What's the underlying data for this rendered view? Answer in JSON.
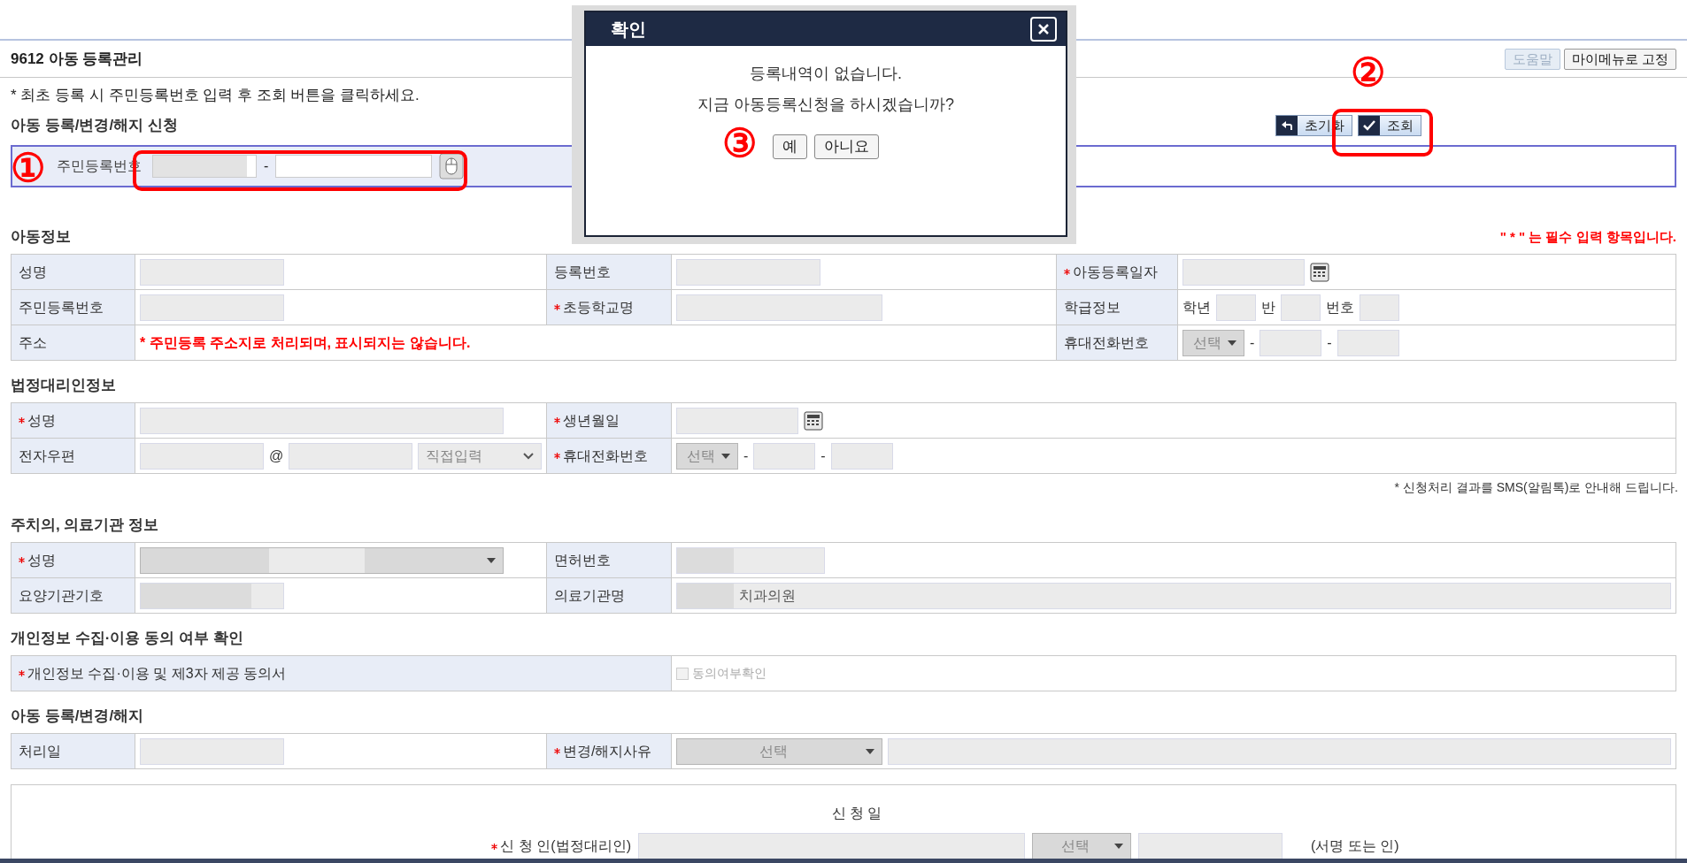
{
  "page": {
    "title": "9612 아동 등록관리",
    "buttons": [
      {
        "label": "도움말",
        "disabled": true
      },
      {
        "label": "마이메뉴로 고정",
        "disabled": false
      }
    ]
  },
  "notice": "* 최초 등록 시 주민등록번호 입력 후 조회 버튼을 클릭하세요.",
  "search": {
    "heading": "아동 등록/변경/해지 신청",
    "buttons": [
      {
        "label": "초기화",
        "kind": "reset"
      },
      {
        "label": "조회",
        "kind": "check"
      }
    ],
    "label": "주민등록번호",
    "separator": "-"
  },
  "sections": [
    {
      "heading": "아동정보",
      "note": "\" * \" 는 필수 입력 항목입니다.",
      "rows": [
        [
          {
            "kind": "label",
            "text": "성명",
            "required": false
          },
          {
            "kind": "value",
            "items": [
              {
                "kind": "input"
              }
            ]
          },
          {
            "kind": "label",
            "text": "등록번호",
            "required": false
          },
          {
            "kind": "value",
            "items": [
              {
                "kind": "input"
              }
            ]
          },
          {
            "kind": "label",
            "text": "아동등록일자",
            "required": true
          },
          {
            "kind": "value",
            "items": [
              {
                "kind": "input"
              },
              {
                "kind": "calendar"
              }
            ]
          }
        ],
        [
          {
            "kind": "label",
            "text": "주민등록번호",
            "required": false
          },
          {
            "kind": "value",
            "items": [
              {
                "kind": "input"
              }
            ]
          },
          {
            "kind": "label",
            "text": "초등학교명",
            "required": true
          },
          {
            "kind": "value",
            "items": [
              {
                "kind": "input"
              }
            ]
          },
          {
            "kind": "label",
            "text": "학급정보",
            "required": false
          },
          {
            "kind": "value",
            "items": [
              {
                "kind": "text",
                "text": "학년"
              },
              {
                "kind": "input"
              },
              {
                "kind": "text",
                "text": "반"
              },
              {
                "kind": "input"
              },
              {
                "kind": "text",
                "text": "번호"
              },
              {
                "kind": "input"
              }
            ]
          }
        ],
        [
          {
            "kind": "label",
            "text": "주소",
            "required": false
          },
          {
            "kind": "note",
            "text": "* 주민등록 주소지로 처리되며, 표시되지는 않습니다."
          },
          "",
          "",
          {
            "kind": "label",
            "text": "휴대전화번호",
            "required": false
          },
          {
            "kind": "value",
            "items": [
              {
                "kind": "select",
                "text": "선택"
              },
              {
                "kind": "text",
                "text": "-"
              },
              {
                "kind": "input"
              },
              {
                "kind": "text",
                "text": "-"
              },
              {
                "kind": "input"
              }
            ]
          }
        ]
      ]
    },
    {
      "heading": "법정대리인정보",
      "footnote": "* 신청처리 결과를 SMS(알림톡)로 안내해 드립니다.",
      "rows": [
        [
          {
            "kind": "label",
            "text": "성명",
            "required": true
          },
          {
            "kind": "value",
            "items": [
              {
                "kind": "input"
              }
            ]
          },
          {
            "kind": "label",
            "text": "생년월일",
            "required": true
          },
          {
            "kind": "value",
            "items": [
              {
                "kind": "input"
              },
              {
                "kind": "calendar"
              }
            ]
          }
        ],
        [
          {
            "kind": "label",
            "text": "전자우편",
            "required": false
          },
          {
            "kind": "value",
            "items": [
              {
                "kind": "input"
              },
              {
                "kind": "text",
                "text": "@"
              },
              {
                "kind": "input"
              },
              {
                "kind": "dropdown",
                "text": "직접입력"
              }
            ]
          },
          {
            "kind": "label",
            "text": "휴대전화번호",
            "required": true
          },
          {
            "kind": "value",
            "items": [
              {
                "kind": "select",
                "text": "선택"
              },
              {
                "kind": "text",
                "text": "-"
              },
              {
                "kind": "input"
              },
              {
                "kind": "text",
                "text": "-"
              },
              {
                "kind": "input"
              }
            ]
          }
        ]
      ]
    },
    {
      "heading": "주치의, 의료기관 정보",
      "rows": [
        [
          {
            "kind": "label",
            "text": "성명",
            "required": true
          },
          {
            "kind": "value",
            "items": [
              {
                "kind": "select",
                "redacted": true
              }
            ]
          },
          {
            "kind": "label",
            "text": "면허번호",
            "required": false
          },
          {
            "kind": "value",
            "items": [
              {
                "kind": "input",
                "redacted": true
              }
            ]
          }
        ],
        [
          {
            "kind": "label",
            "text": "요양기관기호",
            "required": false
          },
          {
            "kind": "value",
            "items": [
              {
                "kind": "input",
                "redacted": true
              }
            ]
          },
          {
            "kind": "label",
            "text": "의료기관명",
            "required": false
          },
          {
            "kind": "value",
            "items": [
              {
                "kind": "input",
                "redacted": true,
                "value": "치과의원"
              }
            ]
          }
        ]
      ]
    },
    {
      "heading": "개인정보 수집·이용 동의 여부 확인",
      "rows": [
        [
          {
            "kind": "label",
            "text": "개인정보 수집·이용 및 제3자 제공 동의서",
            "required": true
          },
          {
            "kind": "value",
            "items": [
              {
                "kind": "checkbox",
                "text": "동의여부확인",
                "checked": false,
                "disabled": true
              }
            ]
          }
        ]
      ]
    },
    {
      "heading": "아동 등록/변경/해지",
      "rows": [
        [
          {
            "kind": "label",
            "text": "처리일",
            "required": false
          },
          {
            "kind": "value",
            "items": [
              {
                "kind": "input"
              }
            ]
          },
          {
            "kind": "label",
            "text": "변경/해지사유",
            "required": true
          },
          {
            "kind": "value",
            "items": [
              {
                "kind": "select",
                "text": "선택"
              },
              {
                "kind": "input"
              }
            ]
          }
        ]
      ]
    }
  ],
  "application": {
    "date_label": "신 청 일",
    "applicant_label": "신 청 인(법정대리인)",
    "required": true,
    "items": [
      {
        "kind": "input"
      },
      {
        "kind": "select",
        "text": "선택"
      },
      {
        "kind": "input"
      }
    ],
    "suffix": "(서명 또는 인)"
  },
  "dialog": {
    "title": "확인",
    "lines": [
      "등록내역이 없습니다.",
      "지금 아동등록신청을 하시겠습니까?"
    ],
    "buttons": [
      "예",
      "아니요"
    ]
  },
  "annotations": [
    "①",
    "②",
    "③"
  ]
}
